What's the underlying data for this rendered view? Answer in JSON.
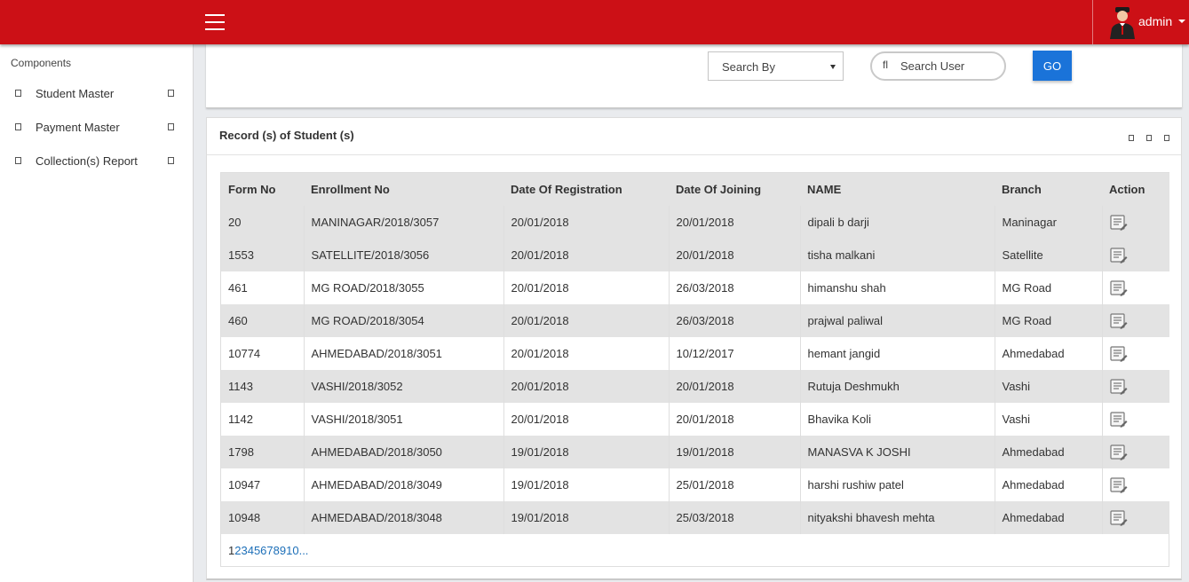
{
  "header": {
    "menu_icon": "hamburger-menu-icon",
    "user": {
      "name": "admin",
      "avatar_icon": "user-avatar-icon"
    },
    "accent_color": "#cc1016"
  },
  "sidebar": {
    "heading": "Components",
    "items": [
      {
        "label": "Student Master"
      },
      {
        "label": "Payment Master"
      },
      {
        "label": "Collection(s) Report"
      }
    ]
  },
  "search": {
    "select_value": "Search By",
    "input_icon": "fl",
    "input_placeholder": "Search User",
    "go_label": "GO",
    "go_color": "#1a73d9"
  },
  "records": {
    "title": "Record (s) of Student (s)",
    "columns": [
      "Form No",
      "Enrollment No",
      "Date Of Registration",
      "Date Of Joining",
      "NAME",
      "Branch",
      "Action"
    ],
    "rows": [
      {
        "form_no": "20",
        "enrollment_no": "MANINAGAR/2018/3057",
        "registration": "20/01/2018",
        "joining": "20/01/2018",
        "name": "dipali b darji",
        "branch": "Maninagar"
      },
      {
        "form_no": "1553",
        "enrollment_no": "SATELLITE/2018/3056",
        "registration": "20/01/2018",
        "joining": "20/01/2018",
        "name": "tisha malkani",
        "branch": "Satellite"
      },
      {
        "form_no": "461",
        "enrollment_no": "MG ROAD/2018/3055",
        "registration": "20/01/2018",
        "joining": "26/03/2018",
        "name": "himanshu shah",
        "branch": "MG Road"
      },
      {
        "form_no": "460",
        "enrollment_no": "MG ROAD/2018/3054",
        "registration": "20/01/2018",
        "joining": "26/03/2018",
        "name": "prajwal paliwal",
        "branch": "MG Road"
      },
      {
        "form_no": "10774",
        "enrollment_no": "AHMEDABAD/2018/3051",
        "registration": "20/01/2018",
        "joining": "10/12/2017",
        "name": "hemant jangid",
        "branch": "Ahmedabad"
      },
      {
        "form_no": "1143",
        "enrollment_no": "VASHI/2018/3052",
        "registration": "20/01/2018",
        "joining": "20/01/2018",
        "name": "Rutuja Deshmukh",
        "branch": "Vashi"
      },
      {
        "form_no": "1142",
        "enrollment_no": "VASHI/2018/3051",
        "registration": "20/01/2018",
        "joining": "20/01/2018",
        "name": "Bhavika Koli",
        "branch": "Vashi"
      },
      {
        "form_no": "1798",
        "enrollment_no": "AHMEDABAD/2018/3050",
        "registration": "19/01/2018",
        "joining": "19/01/2018",
        "name": "MANASVA K JOSHI",
        "branch": "Ahmedabad"
      },
      {
        "form_no": "10947",
        "enrollment_no": "AHMEDABAD/2018/3049",
        "registration": "19/01/2018",
        "joining": "25/01/2018",
        "name": "harshi rushiw patel",
        "branch": "Ahmedabad"
      },
      {
        "form_no": "10948",
        "enrollment_no": "AHMEDABAD/2018/3048",
        "registration": "19/01/2018",
        "joining": "25/03/2018",
        "name": "nityakshi bhavesh mehta",
        "branch": "Ahmedabad"
      }
    ],
    "row_shading": [
      "shaded",
      "shaded",
      "plain",
      "shaded",
      "plain",
      "shaded",
      "plain",
      "shaded",
      "plain",
      "shaded"
    ],
    "action_icon": "edit-record-icon",
    "pagination": [
      "1",
      "2",
      "3",
      "4",
      "5",
      "6",
      "7",
      "8",
      "9",
      "10",
      "..."
    ]
  }
}
